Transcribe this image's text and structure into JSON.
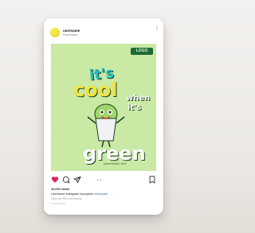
{
  "post": {
    "username": "username",
    "location": "Placeholder",
    "poster": {
      "brand": "LOGO",
      "line1": "it's",
      "line2": "cool",
      "line3": "when",
      "line4": "it's",
      "line5": "green",
      "small": "placeholder text"
    },
    "likes": "10,000 views",
    "caption_user": "Username",
    "caption_text": " instagram inscription ",
    "caption_tag": "#template",
    "comments": "View all 300 comments",
    "time": "1 HOUR AGO"
  },
  "colors": {
    "poster_bg": "#c9e9a5",
    "heart": "#e0245e",
    "brand_bg": "#1e6b34"
  }
}
